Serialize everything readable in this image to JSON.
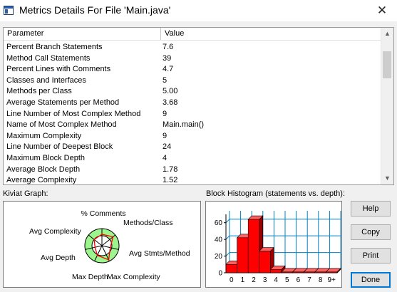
{
  "window": {
    "title": "Metrics Details For File 'Main.java'",
    "close_glyph": "✕"
  },
  "table": {
    "columns": [
      "Parameter",
      "Value"
    ],
    "rows": [
      {
        "parameter": "Percent Branch Statements",
        "value": "7.6"
      },
      {
        "parameter": "Method Call Statements",
        "value": "39"
      },
      {
        "parameter": "Percent Lines with Comments",
        "value": "4.7"
      },
      {
        "parameter": "Classes and Interfaces",
        "value": "5"
      },
      {
        "parameter": "Methods per Class",
        "value": "5.00"
      },
      {
        "parameter": "Average Statements per Method",
        "value": "3.68"
      },
      {
        "parameter": "Line Number of Most Complex Method",
        "value": "9"
      },
      {
        "parameter": "Name of Most Complex Method",
        "value": "Main.main()"
      },
      {
        "parameter": "Maximum Complexity",
        "value": "9"
      },
      {
        "parameter": "Line Number of Deepest Block",
        "value": "24"
      },
      {
        "parameter": "Maximum Block Depth",
        "value": "4"
      },
      {
        "parameter": "Average Block Depth",
        "value": "1.78"
      },
      {
        "parameter": "Average Complexity",
        "value": "1.52"
      }
    ],
    "scroll_up_glyph": "▲",
    "scroll_down_glyph": "▼"
  },
  "kiviat": {
    "label": "Kiviat Graph:",
    "axes": [
      "% Comments",
      "Methods/Class",
      "Avg Stmts/Method",
      "Max Complexity",
      "Max Depth",
      "Avg Depth",
      "Avg Complexity"
    ],
    "colors": {
      "band": "#9df58d",
      "polygon": "#ff0000",
      "axis": "#000000",
      "center": "#ffffff"
    }
  },
  "histogram": {
    "label": "Block Histogram (statements vs. depth):",
    "colors": {
      "bar": "#ff0000",
      "bar_top": "#ff6060",
      "bar_side": "#9a0000",
      "grid": "#0080c0"
    }
  },
  "chart_data": {
    "type": "bar",
    "title": "Block Histogram (statements vs. depth):",
    "categories": [
      "0",
      "1",
      "2",
      "3",
      "4",
      "5",
      "6",
      "7",
      "8",
      "9+"
    ],
    "values": [
      10,
      42,
      64,
      26,
      4,
      1,
      1,
      1,
      1,
      1
    ],
    "yticks": [
      0,
      20,
      40,
      60
    ],
    "ylim": [
      0,
      70
    ],
    "grid": true
  },
  "buttons": {
    "help": "Help",
    "copy": "Copy",
    "print": "Print",
    "done": "Done"
  }
}
